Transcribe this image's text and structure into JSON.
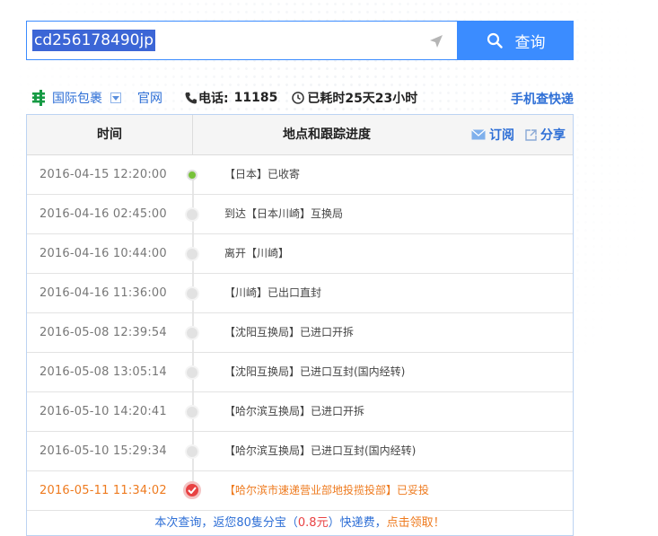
{
  "search": {
    "value": "cd256178490jp",
    "button_label": "查询"
  },
  "info": {
    "service_label": "国际包裹",
    "official_label": "官网",
    "phone_label": "电话:",
    "phone_number": "11185",
    "elapsed_label": "已耗时25天23小时",
    "mobile_link": "手机查快递"
  },
  "table": {
    "col_time": "时间",
    "col_location": "地点和跟踪进度",
    "subscribe_label": "订阅",
    "share_label": "分享",
    "rows": [
      {
        "time": "2016-04-15 12:20:00",
        "detail": "【日本】已收寄"
      },
      {
        "time": "2016-04-16 02:45:00",
        "detail": "到达【日本川崎】互换局"
      },
      {
        "time": "2016-04-16 10:44:00",
        "detail": "离开【川崎】"
      },
      {
        "time": "2016-04-16 11:36:00",
        "detail": "【川崎】已出口直封"
      },
      {
        "time": "2016-05-08 12:39:54",
        "detail": "【沈阳互换局】已进口开拆"
      },
      {
        "time": "2016-05-08 13:05:14",
        "detail": "【沈阳互换局】已进口互封(国内经转)"
      },
      {
        "time": "2016-05-10 14:20:41",
        "detail": "【哈尔滨互换局】已进口开拆"
      },
      {
        "time": "2016-05-10 15:29:34",
        "detail": "【哈尔滨互换局】已进口互封(国内经转)"
      },
      {
        "time": "2016-05-11 11:34:02",
        "detail": "【哈尔滨市速递营业部地投揽投部】已妥投"
      }
    ],
    "footer_part1": "本次查询，返您80隻分宝（",
    "footer_amount": "0.8元",
    "footer_part2": "）快递费，",
    "footer_claim": "点击领取！"
  },
  "colors": {
    "accent": "#3b8cff",
    "link": "#2e6fd6",
    "delivered": "#ee7a1e",
    "done_dot": "#e84142",
    "start_dot": "#77c23a"
  }
}
